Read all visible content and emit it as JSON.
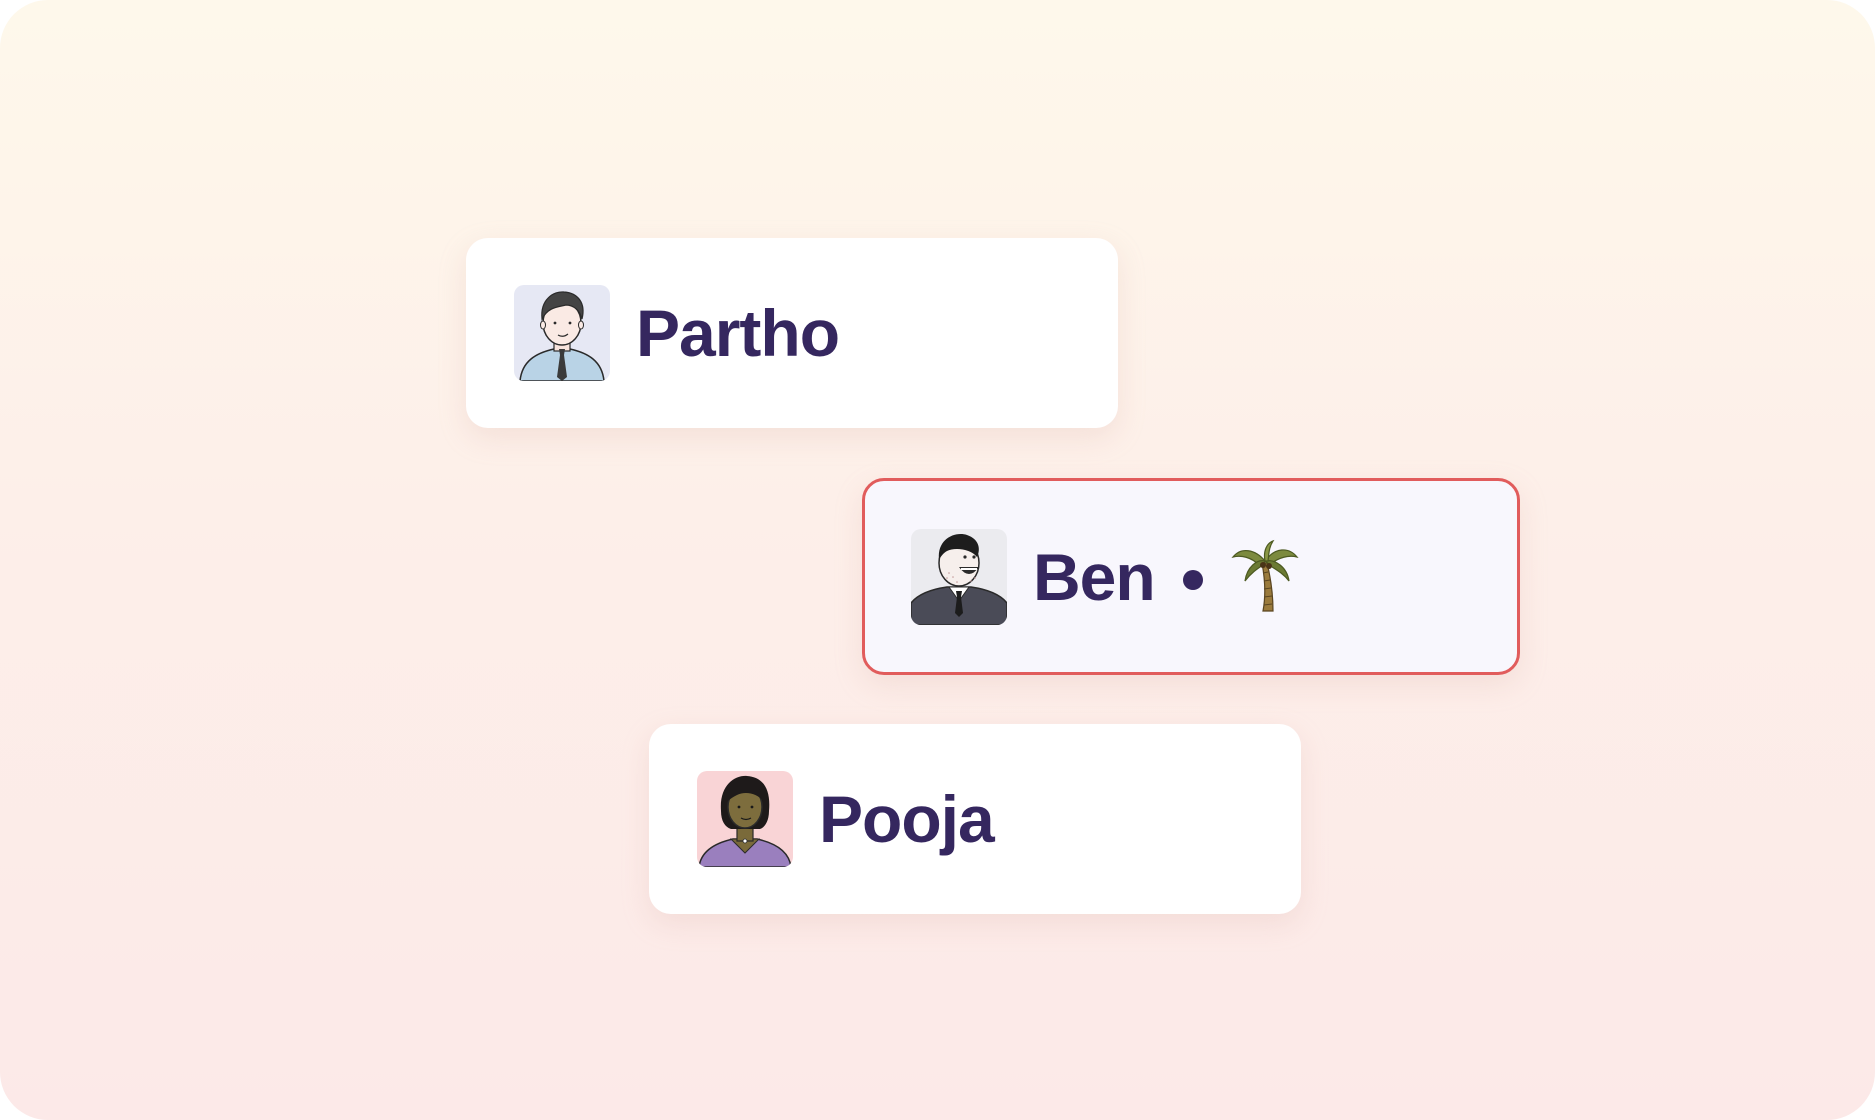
{
  "users": [
    {
      "name": "Partho",
      "avatar_icon": "partho-avatar-icon",
      "avatar_bg": "#e6e8f4",
      "selected": false
    },
    {
      "name": "Ben",
      "avatar_icon": "ben-avatar-icon",
      "avatar_bg": "#ebebef",
      "selected": true,
      "status_icon": "palm-tree-icon"
    },
    {
      "name": "Pooja",
      "avatar_icon": "pooja-avatar-icon",
      "avatar_bg": "#f9d4d6",
      "selected": false
    }
  ],
  "colors": {
    "name_text": "#35275f",
    "selected_border": "#e15c5c",
    "background_top": "#fef8eb",
    "background_bottom": "#fce9e8"
  }
}
